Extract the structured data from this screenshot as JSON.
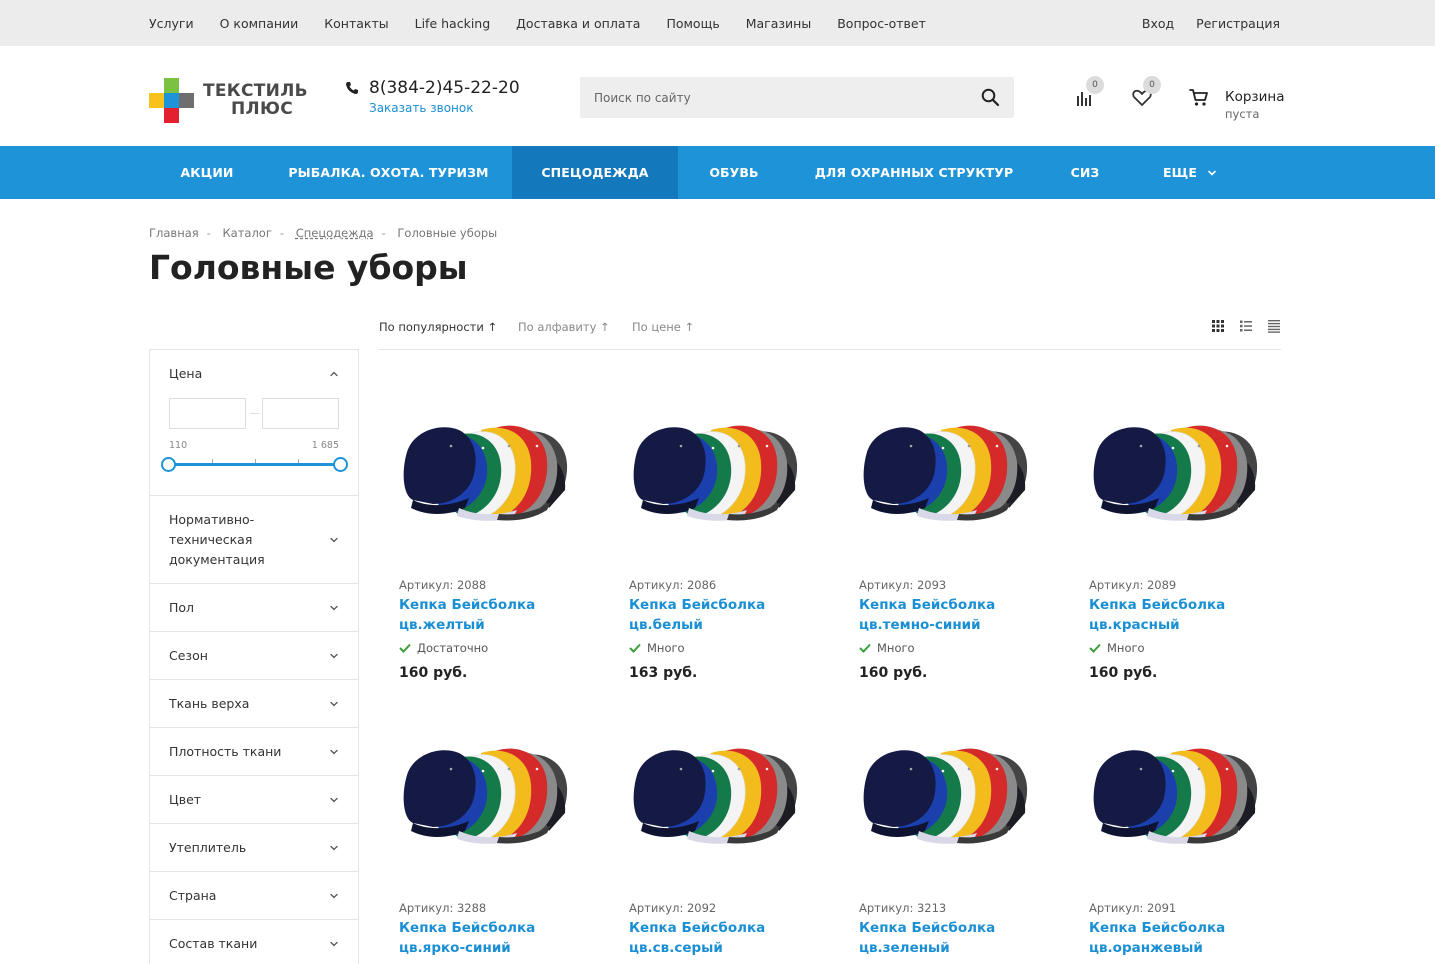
{
  "topbar": {
    "links": [
      "Услуги",
      "О компании",
      "Контакты",
      "Life hacking",
      "Доставка и оплата",
      "Помощь",
      "Магазины",
      "Вопрос-ответ"
    ],
    "login": "Вход",
    "register": "Регистрация"
  },
  "header": {
    "logo_line1": "ТЕКСТИЛЬ",
    "logo_line2": "ПЛЮС",
    "phone": "8(384-2)45-22-20",
    "callback": "Заказать звонок",
    "search_placeholder": "Поиск по сайту",
    "compare_count": "0",
    "favorites_count": "0",
    "cart_title": "Корзина",
    "cart_status": "пуста"
  },
  "menu": [
    "АКЦИИ",
    "РЫБАЛКА. ОХОТА. ТУРИЗМ",
    "СПЕЦОДЕЖДА",
    "ОБУВЬ",
    "ДЛЯ ОХРАННЫХ СТРУКТУР",
    "СИЗ",
    "ЕЩЕ"
  ],
  "breadcrumb": [
    "Главная",
    "Каталог",
    "Спецодежда",
    "Головные уборы"
  ],
  "page_title": "Головные уборы",
  "sort": {
    "popular": "По популярности",
    "alpha": "По алфавиту",
    "price": "По цене"
  },
  "filters": {
    "price_title": "Цена",
    "price_min": "110",
    "price_max": "1 685",
    "groups": [
      "Нормативно-техническая документация",
      "Пол",
      "Сезон",
      "Ткань верха",
      "Плотность ткани",
      "Цвет",
      "Утеплитель",
      "Страна",
      "Состав ткани"
    ]
  },
  "products": [
    {
      "article": "Артикул: 2088",
      "name": "Кепка Бейсболка цв.желтый",
      "stock": "Достаточно",
      "price": "160 руб."
    },
    {
      "article": "Артикул: 2086",
      "name": "Кепка Бейсболка цв.белый",
      "stock": "Много",
      "price": "163 руб."
    },
    {
      "article": "Артикул: 2093",
      "name": "Кепка Бейсболка цв.темно-синий",
      "stock": "Много",
      "price": "160 руб."
    },
    {
      "article": "Артикул: 2089",
      "name": "Кепка Бейсболка цв.красный",
      "stock": "Много",
      "price": "160 руб."
    },
    {
      "article": "Артикул: 3288",
      "name": "Кепка Бейсболка цв.ярко-синий"
    },
    {
      "article": "Артикул: 2092",
      "name": "Кепка Бейсболка цв.св.серый"
    },
    {
      "article": "Артикул: 3213",
      "name": "Кепка Бейсболка цв.зеленый"
    },
    {
      "article": "Артикул: 2091",
      "name": "Кепка Бейсболка цв.оранжевый"
    }
  ],
  "colors": {
    "accent": "#1e93d8",
    "accent_dark": "#1478bd",
    "link": "#1a8fd4",
    "stock_check": "#3aa13a"
  }
}
